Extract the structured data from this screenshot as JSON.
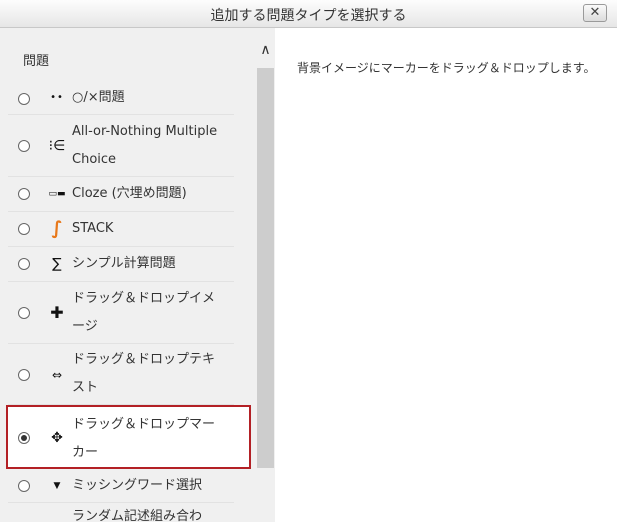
{
  "dialog": {
    "title": "追加する問題タイプを選択する",
    "close_label": "✕"
  },
  "sidebar": {
    "section_label": "問題",
    "scroll_up_label": "∧",
    "items": [
      {
        "label": "○/×問題",
        "icon": "dots-icon",
        "glyph": "••",
        "selected": false
      },
      {
        "label": "All-or-Nothing Multiple Choice",
        "icon": "multichoice-icon",
        "glyph": "⁝∈",
        "selected": false
      },
      {
        "label": "Cloze (穴埋め問題)",
        "icon": "cloze-icon",
        "glyph": "▭▬",
        "selected": false
      },
      {
        "label": "STACK",
        "icon": "stack-icon",
        "glyph": "∫",
        "selected": false
      },
      {
        "label": "シンプル計算問題",
        "icon": "calculated-icon",
        "glyph": "∑",
        "selected": false
      },
      {
        "label": "ドラッグ＆ドロップイメージ",
        "icon": "move-icon",
        "glyph": "✚",
        "selected": false
      },
      {
        "label": "ドラッグ＆ドロップテキスト",
        "icon": "drag-text-icon",
        "glyph": "⇔",
        "selected": false
      },
      {
        "label": "ドラッグ＆ドロップマーカー",
        "icon": "drag-marker-icon",
        "glyph": "✥",
        "selected": true
      },
      {
        "label": "ミッシングワード選択",
        "icon": "dropdown-icon",
        "glyph": "▼",
        "selected": false
      },
      {
        "label": "ランダム記述組み合わ",
        "icon": "random-match-icon",
        "glyph": "",
        "selected": false
      }
    ]
  },
  "detail": {
    "description": "背景イメージにマーカーをドラッグ＆ドロップします。"
  },
  "colors": {
    "selection_border": "#b32025",
    "panel_bg": "#f0f0f0"
  }
}
